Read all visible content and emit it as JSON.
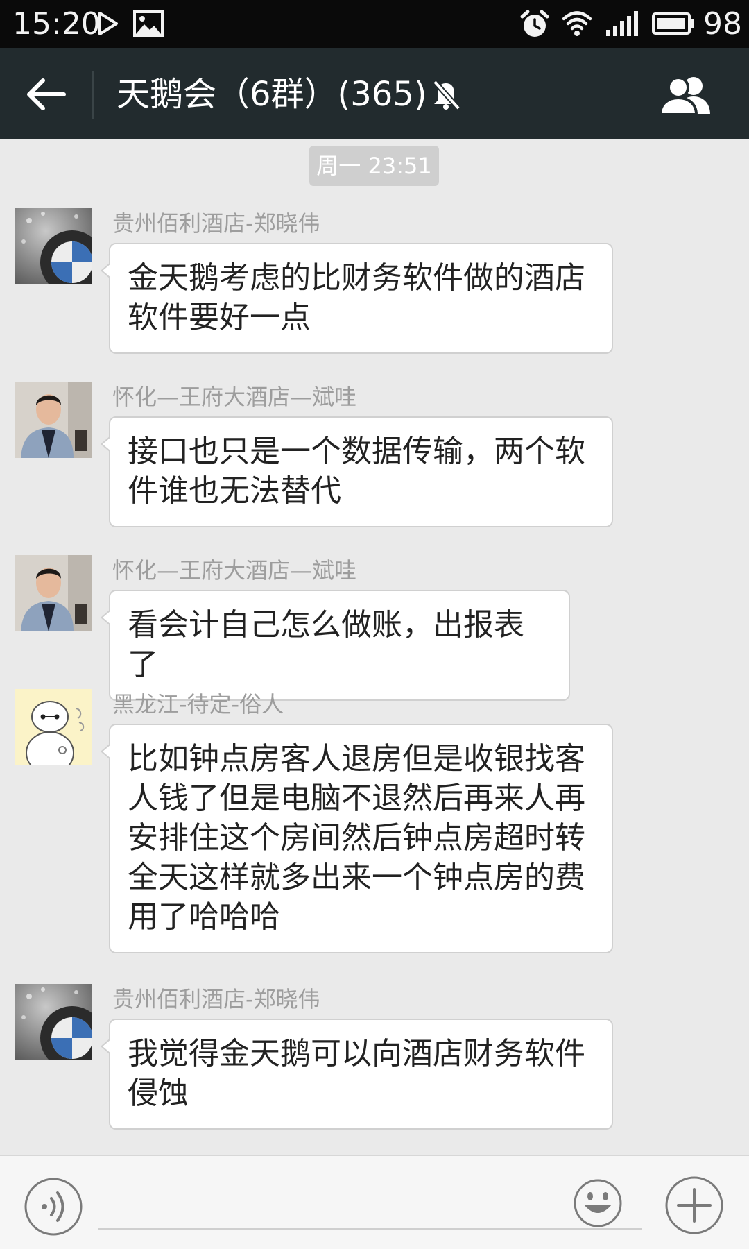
{
  "status_bar": {
    "time": "15:20",
    "battery_level": "98",
    "icons": [
      "play-icon",
      "gallery-icon",
      "alarm-icon",
      "wifi-icon",
      "signal-icon",
      "battery-icon"
    ]
  },
  "header": {
    "title": "天鹅会（6群）(365)",
    "icons": [
      "back-arrow-icon",
      "mute-icon",
      "group-members-icon"
    ]
  },
  "messages_time": "周一 23:51",
  "messages": [
    {
      "sender": "贵州佰利酒店-郑晓伟",
      "avatar": "car-logo-avatar",
      "text": "金天鹅考虑的比财务软件做的酒店软件要好一点"
    },
    {
      "sender": "怀化—王府大酒店—斌哇",
      "avatar": "man-portrait-avatar",
      "text": "接口也只是一个数据传输，两个软件谁也无法替代"
    },
    {
      "sender": "怀化—王府大酒店—斌哇",
      "avatar": "man-portrait-avatar",
      "text": "看会计自己怎么做账，出报表了"
    },
    {
      "sender": "黑龙江-待定-俗人",
      "avatar": "cartoon-robot-avatar",
      "text": "比如钟点房客人退房但是收银找客人钱了但是电脑不退然后再来人再安排住这个房间然后钟点房超时转全天这样就多出来一个钟点房的费用了哈哈哈"
    },
    {
      "sender": "贵州佰利酒店-郑晓伟",
      "avatar": "car-logo-avatar",
      "text": "我觉得金天鹅可以向酒店财务软件侵蚀"
    }
  ],
  "input_bar": {
    "placeholder": "",
    "icons": [
      "voice-icon",
      "emoji-icon",
      "plus-icon"
    ]
  }
}
